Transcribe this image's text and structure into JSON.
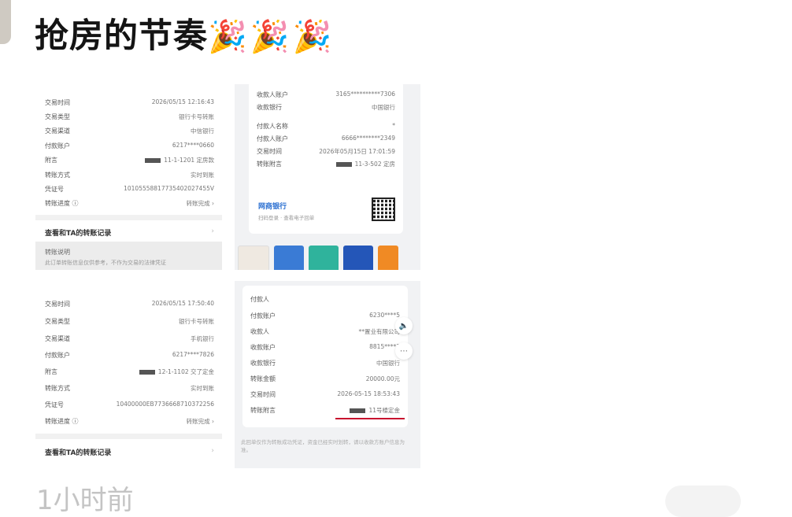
{
  "post": {
    "title": "抢房的节奏",
    "emoji": "🎉🎉🎉",
    "time": "1小时前"
  },
  "shot1": {
    "rows": [
      {
        "k": "交易时间",
        "v": "2026/05/15 12:16:43"
      },
      {
        "k": "交易类型",
        "v": "银行卡号转账"
      },
      {
        "k": "交易渠道",
        "v": "中信银行"
      },
      {
        "k": "付款账户",
        "v": "6217****0660"
      },
      {
        "k": "附言",
        "v": "11-1-1201 定房款"
      },
      {
        "k": "转账方式",
        "v": "实时到账"
      },
      {
        "k": "凭证号",
        "v": "10105558817735402027455V"
      },
      {
        "k": "转账进度 ⓘ",
        "v": "转账完成 ›"
      }
    ],
    "link": "查看和TA的转账记录",
    "box_title": "转账说明",
    "box_text": "此订单转账信息仅供参考，不作为交易的法律凭证"
  },
  "shot2": {
    "rows_top": [
      {
        "k": "收款人账户",
        "v": "3165**********7306"
      },
      {
        "k": "收款银行",
        "v": "中国银行"
      }
    ],
    "rows": [
      {
        "k": "付款人名称",
        "v": "*"
      },
      {
        "k": "付款人账户",
        "v": "6666********2349"
      },
      {
        "k": "交易时间",
        "v": "2026年05月15日 17:01:59"
      },
      {
        "k": "转账附言",
        "v": "11-3-502 定房"
      }
    ],
    "brand": "网商银行",
    "brand_sub": "扫码登录 · 查看电子回单"
  },
  "shot3": {
    "rows": [
      {
        "k": "交易时间",
        "v": "2026/05/15 17:50:40"
      },
      {
        "k": "交易类型",
        "v": "银行卡号转账"
      },
      {
        "k": "交易渠道",
        "v": "手机银行"
      },
      {
        "k": "付款账户",
        "v": "6217****7826"
      },
      {
        "k": "附言",
        "v": "12-1-1102 交了定金"
      },
      {
        "k": "转账方式",
        "v": "实时到账"
      },
      {
        "k": "凭证号",
        "v": "10400000EB7736668710372256"
      },
      {
        "k": "转账进度 ⓘ",
        "v": "转账完成 ›"
      }
    ],
    "link": "查看和TA的转账记录"
  },
  "shot4": {
    "rows": [
      {
        "k": "付款人",
        "v": ""
      },
      {
        "k": "付款账户",
        "v": "6230****5"
      },
      {
        "k": "收款人",
        "v": "**置业有限公司"
      },
      {
        "k": "收款账户",
        "v": "8815****7"
      },
      {
        "k": "收款银行",
        "v": "中国银行"
      },
      {
        "k": "转账金额",
        "v": "20000.00元"
      },
      {
        "k": "交易时间",
        "v": "2026-05-15 18:53:43"
      },
      {
        "k": "转账附言",
        "v": "11号楼定金"
      }
    ],
    "note": "此回单仅作为转账成功凭证，资金已经实时划转，请以收款方账户信息为准。"
  },
  "colors": {
    "accent_red": "#c8102e",
    "brand_blue": "#2a6fd1"
  }
}
